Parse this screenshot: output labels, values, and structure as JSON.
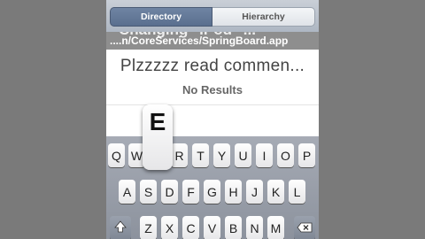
{
  "nav": {
    "tab_left": "Directory",
    "tab_right": "Hierarchy"
  },
  "path": "....n/CoreServices/SpringBoard.app",
  "ghost_text": "Changing \"iPod\" ...",
  "search_title": "Plzzzzz read commen...",
  "no_results": "No Results",
  "popup_key": "E",
  "keyboard": {
    "row1": [
      "Q",
      "W",
      "E",
      "R",
      "T",
      "Y",
      "U",
      "I",
      "O",
      "P"
    ],
    "row2": [
      "A",
      "S",
      "D",
      "F",
      "G",
      "H",
      "J",
      "K",
      "L"
    ],
    "row3": [
      "Z",
      "X",
      "C",
      "V",
      "B",
      "N",
      "M"
    ]
  },
  "icons": {
    "shift": "shift-icon",
    "delete": "delete-icon"
  }
}
